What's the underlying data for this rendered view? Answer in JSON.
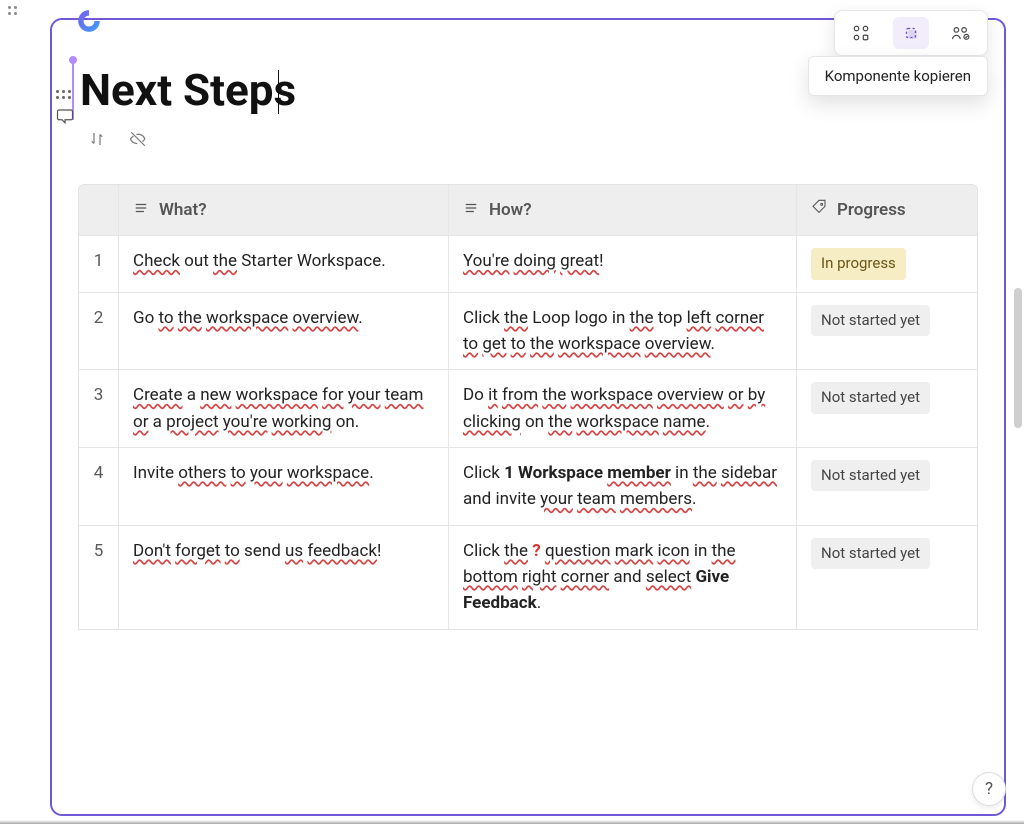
{
  "tooltip": "Komponente kopieren",
  "title": "Next Steps",
  "columns": {
    "what": "What?",
    "how": "How?",
    "progress": "Progress"
  },
  "badge_labels": {
    "in_progress": "In progress",
    "not_started": "Not started yet"
  },
  "rows": [
    {
      "n": "1",
      "what_html": "<span class='spell'>Check</span> out <span class='spell'>the</span> Starter Workspace.",
      "how_html": "<span class='spell'>You're</span> <span class='spell'>doing</span> <span class='spell'>great</span>!",
      "status": "in_progress"
    },
    {
      "n": "2",
      "what_html": "Go <span class='spell'>to</span> <span class='spell'>the</span> <span class='spell'>workspace</span> <span class='spell'>overview</span>.",
      "how_html": "Click <span class='spell'>the</span> Loop logo in <span class='spell'>the</span> top <span class='spell'>left</span> <span class='spell'>corner</span> <span class='spell'>to</span> <span class='spell'>get</span> <span class='spell'>to</span> <span class='spell'>the</span> <span class='spell'>workspace</span> <span class='spell'>overview</span>.",
      "status": "not_started"
    },
    {
      "n": "3",
      "what_html": "<span class='spell'>Create</span> a <span class='spell'>new</span> <span class='spell'>workspace</span> <span class='spell'>for</span> <span class='spell'>your</span> <span class='spell'>team</span> <span class='spell'>or</span> a <span class='spell'>project</span> <span class='spell'>you're</span> <span class='spell'>working</span> on.",
      "how_html": "Do <span class='spell'>it</span> <span class='spell'>from</span> <span class='spell'>the</span> <span class='spell'>workspace</span> <span class='spell'>overview</span> <span class='spell'>or</span> <span class='spell'>by</span> <span class='spell'>clicking</span> on <span class='spell'>the</span> <span class='spell'>workspace</span> <span class='spell'>name</span>.",
      "status": "not_started"
    },
    {
      "n": "4",
      "what_html": "Invite <span class='spell'>others</span> <span class='spell'>to</span> <span class='spell'>your</span> <span class='spell'>workspace</span>.",
      "how_html": "Click <span class='strong'>1 Workspace <span class='spell'>member</span></span> in <span class='spell'>the</span> <span class='spell'>sidebar</span> and invite <span class='spell'>your</span> <span class='spell'>team</span> <span class='spell'>members</span>.",
      "status": "not_started"
    },
    {
      "n": "5",
      "what_html": "<span class='spell'>Don't</span> <span class='spell'>forget</span> <span class='spell'>to</span> send <span class='spell'>us</span> <span class='spell'>feedback</span>!",
      "how_html": "Click <span class='spell'>the</span> <span class='qmark'>?</span> <span class='spell'>question</span> <span class='spell'>mark</span> <span class='spell'>icon</span> in <span class='spell'>the</span> <span class='spell'>bottom</span> <span class='spell'>right</span> <span class='spell'>corner</span> and <span class='spell'>select</span> <span class='strong'>Give Feedback</span>.",
      "status": "not_started"
    }
  ],
  "help": "?"
}
